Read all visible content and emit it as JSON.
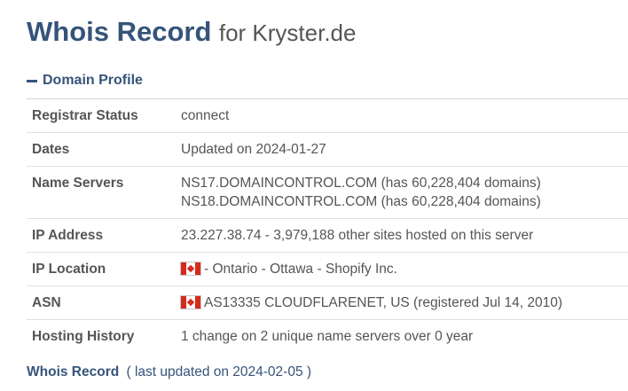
{
  "header": {
    "title": "Whois Record",
    "subtitle": "for Kryster.de"
  },
  "section": {
    "label": "Domain Profile"
  },
  "profile_rows": [
    {
      "label": "Registrar Status",
      "lines": [
        "connect"
      ]
    },
    {
      "label": "Dates",
      "lines": [
        "Updated on 2024-01-27"
      ]
    },
    {
      "label": "Name Servers",
      "lines": [
        "NS17.DOMAINCONTROL.COM (has 60,228,404 domains)",
        "NS18.DOMAINCONTROL.COM (has 60,228,404 domains)"
      ]
    },
    {
      "label": "IP Address",
      "lines": [
        "23.227.38.74 - 3,979,188 other sites hosted on this server"
      ]
    },
    {
      "label": "IP Location",
      "lines": [
        "- Ontario - Ottawa - Shopify Inc."
      ],
      "flag": "canada-flag-icon"
    },
    {
      "label": "ASN",
      "lines": [
        "AS13335 CLOUDFLARENET, US (registered Jul 14, 2010)"
      ],
      "flag": "canada-flag-icon"
    },
    {
      "label": "Hosting History",
      "lines": [
        "1 change on 2 unique name servers over 0 year"
      ]
    }
  ],
  "footer": {
    "link_label": "Whois Record",
    "updated_text": "( last updated on 2024-02-05 )"
  },
  "colors": {
    "brand_blue": "#365479",
    "text_gray": "#555555",
    "rule_gray": "#e0e0e0",
    "flag_red": "#d52b1e"
  }
}
